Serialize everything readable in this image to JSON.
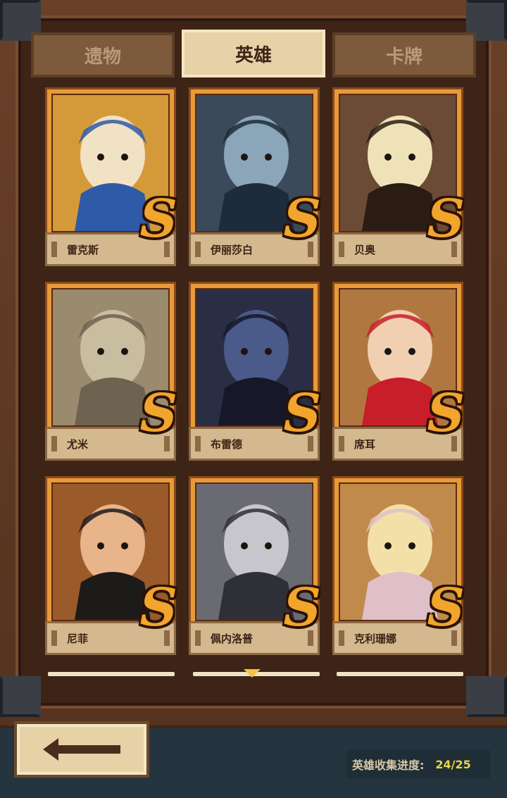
{
  "tabs": [
    {
      "label": "遗物",
      "active": false
    },
    {
      "label": "英雄",
      "active": true
    },
    {
      "label": "卡牌",
      "active": false
    }
  ],
  "heroes": [
    {
      "name": "雷克斯",
      "rank": "S",
      "palette": [
        "#d49a3a",
        "#f2e2c4",
        "#2f5aa8"
      ]
    },
    {
      "name": "伊丽莎白",
      "rank": "S",
      "palette": [
        "#3b4a5a",
        "#8aa6b8",
        "#1e2b3a"
      ]
    },
    {
      "name": "贝奥",
      "rank": "S",
      "palette": [
        "#6b4a36",
        "#efe2b8",
        "#2b1c14"
      ]
    },
    {
      "name": "尤米",
      "rank": "S",
      "palette": [
        "#9a8a6e",
        "#c9bda0",
        "#6e6250"
      ]
    },
    {
      "name": "布雷德",
      "rank": "S",
      "palette": [
        "#2a2e44",
        "#4a5a8a",
        "#161827"
      ]
    },
    {
      "name": "席耳",
      "rank": "S",
      "palette": [
        "#b07840",
        "#f0d0b0",
        "#c81e2a"
      ]
    },
    {
      "name": "尼菲",
      "rank": "S",
      "palette": [
        "#9a5a2a",
        "#e8b48a",
        "#1d1a1a"
      ]
    },
    {
      "name": "佩内洛普",
      "rank": "S",
      "palette": [
        "#6a6a72",
        "#c6c6cc",
        "#2f2f38"
      ]
    },
    {
      "name": "克利珊娜",
      "rank": "S",
      "palette": [
        "#c08a4a",
        "#f3e0a8",
        "#e0c0c8"
      ]
    }
  ],
  "collection": {
    "label": "英雄收集进度:",
    "value": "24/25"
  },
  "icons": {
    "back": "arrow-left-icon"
  },
  "colors": {
    "rank_s": "#f1a52c",
    "tab_active": "#e7d2a8",
    "progress_value": "#e8d44a"
  }
}
